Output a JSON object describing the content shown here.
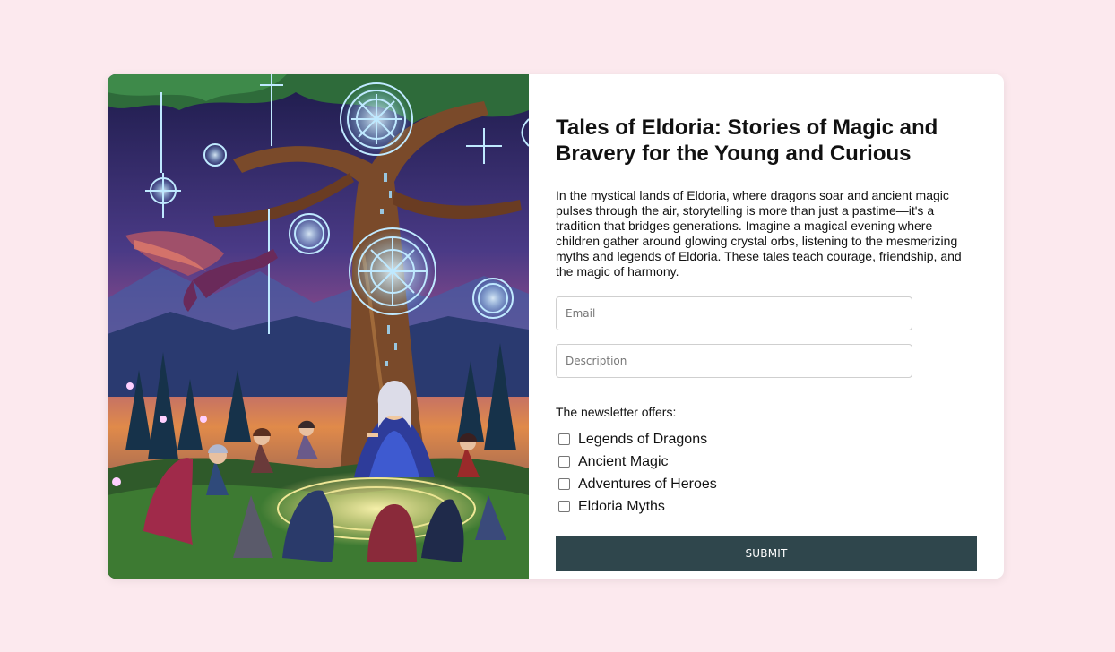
{
  "hero_image": {
    "alt": "pixel art illustration of a storyteller beneath a glowing magical tree with children and a dragon",
    "colors": {
      "sky_top": "#1d1b4a",
      "sky_mid": "#5a3a7a",
      "sunset": "#e08a4a",
      "tree": "#7a4a2a",
      "leaves": "#2e6b3a",
      "rune_glow": "#bfe9ff",
      "ground_glow": "#f5e08a"
    }
  },
  "form": {
    "title": "Tales of Eldoria: Stories of Magic and Bravery for the Young and Curious",
    "description": "In the mystical lands of Eldoria, where dragons soar and ancient magic pulses through the air, storytelling is more than just a pastime—it's a tradition that bridges generations. Imagine a magical evening where children gather around glowing crystal orbs, listening to the mesmerizing myths and legends of Eldoria. These tales teach courage, friendship, and the magic of harmony.",
    "email_placeholder": "Email",
    "email_value": "",
    "description_placeholder": "Description",
    "description_value": "",
    "offers_label": "The newsletter offers:",
    "offers": [
      {
        "label": "Legends of Dragons",
        "checked": false
      },
      {
        "label": "Ancient Magic",
        "checked": false
      },
      {
        "label": "Adventures of Heroes",
        "checked": false
      },
      {
        "label": "Eldoria Myths",
        "checked": false
      }
    ],
    "submit_label": "SUBMIT"
  },
  "colors": {
    "page_background": "#fce9ee",
    "button_background": "#2f464c",
    "button_text": "#ffffff"
  }
}
